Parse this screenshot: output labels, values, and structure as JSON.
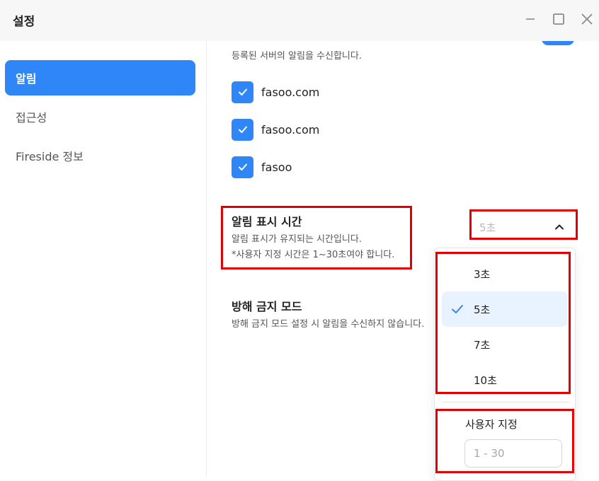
{
  "window": {
    "title": "설정"
  },
  "sidebar": {
    "items": [
      {
        "label": "알림",
        "active": true
      },
      {
        "label": "접근성",
        "active": false
      },
      {
        "label": "Fireside 정보",
        "active": false
      }
    ]
  },
  "notifications": {
    "server_desc": "등록된 서버의 알림을 수신합니다.",
    "servers": [
      {
        "label": "fasoo.com",
        "checked": true
      },
      {
        "label": "fasoo.com",
        "checked": true
      },
      {
        "label": "fasoo",
        "checked": true
      }
    ],
    "display_time": {
      "title": "알림 표시 시간",
      "desc_line1": "알림 표시가 유지되는 시간입니다.",
      "desc_line2": "*사용자 지정 시간은 1~30초여야 합니다.",
      "selected": "5초"
    },
    "dnd": {
      "title": "방해 금지 모드",
      "desc": "방해 금지 모드 설정 시 알림을 수신하지 않습니다."
    }
  },
  "dropdown": {
    "options": [
      "3초",
      "5초",
      "7초",
      "10초"
    ],
    "selected_index": 1,
    "custom_label": "사용자 지정",
    "custom_placeholder": "1 - 30"
  },
  "colors": {
    "accent": "#2f86f6",
    "highlight": "#e00000"
  }
}
